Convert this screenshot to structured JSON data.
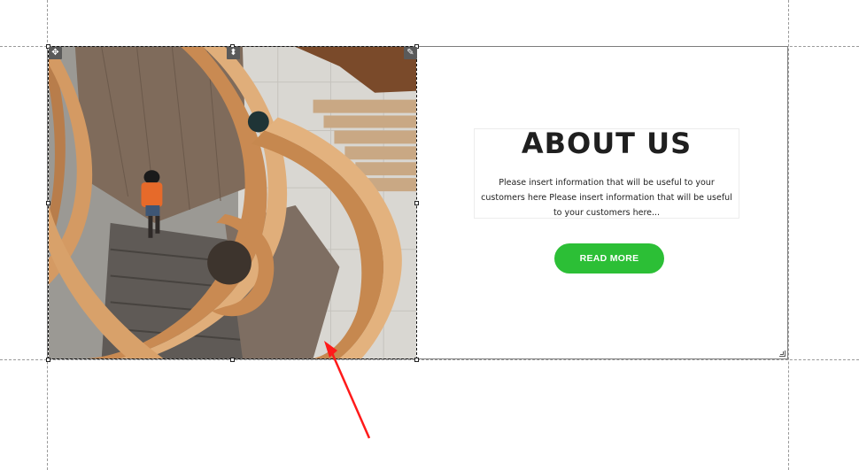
{
  "about": {
    "title": "ABOUT US",
    "text": "Please insert information that will be useful to your customers here Please insert information that will be useful to your customers here...",
    "button_label": "READ MORE"
  },
  "toolbar_icons": {
    "move": "✥",
    "arrange": "⬍",
    "edit": "✎"
  },
  "image": {
    "subject": "spiral wooden staircase"
  },
  "colors": {
    "button": "#2cbf36",
    "annotation_arrow": "#ff1a1a"
  }
}
